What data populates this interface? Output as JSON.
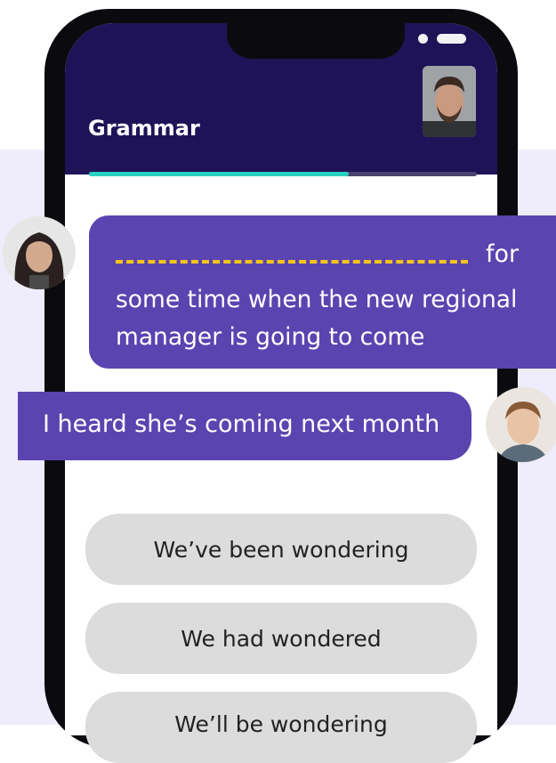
{
  "header": {
    "title": "Grammar",
    "progress": 0.67
  },
  "chat": {
    "prompt_blank_word": "for",
    "prompt_rest": "some time when the new regional manager is going to come",
    "reply": "I heard she’s coming next month"
  },
  "options": [
    "We’ve been wondering",
    "We had wondered",
    "We’ll be wondering"
  ],
  "colors": {
    "header_bg": "#1E1357",
    "bubble": "#5A44B0",
    "progress": "#2BD1C0",
    "blank_dash": "#F5C51B",
    "option_bg": "#DCDCDC",
    "page_bg": "#EFECFB"
  }
}
